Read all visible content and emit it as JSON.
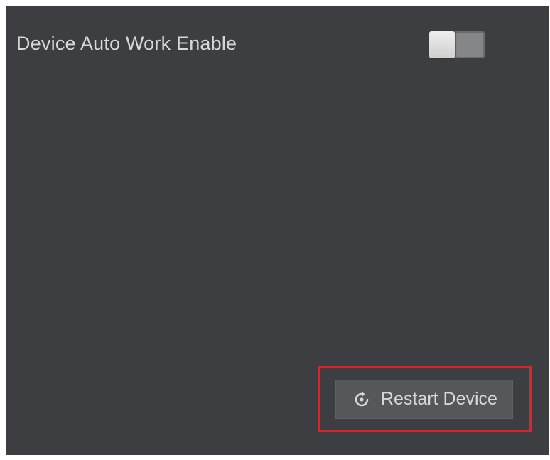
{
  "settings": {
    "auto_work_label": "Device Auto Work Enable",
    "auto_work_enabled": false
  },
  "actions": {
    "restart_label": "Restart Device",
    "restart_icon": "restart-icon",
    "highlight_color": "#d9242b"
  },
  "colors": {
    "panel_bg": "#3d3e41",
    "text": "#d6d7d9",
    "button_bg": "#55575a"
  }
}
